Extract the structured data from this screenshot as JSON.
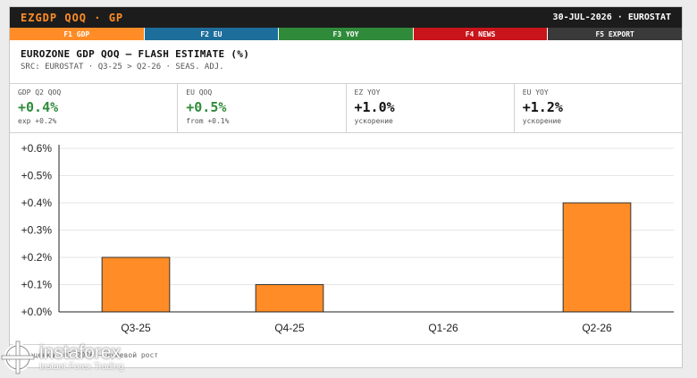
{
  "app": {
    "title": "EZGDP QOQ · GP",
    "date_source": "30-JUL-2026 · EUROSTAT"
  },
  "fkeys": [
    {
      "label": "F1 GDP",
      "color": "#ff8c26"
    },
    {
      "label": "F2 EU",
      "color": "#1e6e9c"
    },
    {
      "label": "F3 YOY",
      "color": "#2f8b3a"
    },
    {
      "label": "F4 NEWS",
      "color": "#c8141a"
    },
    {
      "label": "F5 EXPORT",
      "color": "#3a3a3a"
    }
  ],
  "header": {
    "title": "EUROZONE GDP QOQ — FLASH ESTIMATE (%)",
    "subtitle": "SRC: EUROSTAT · Q3-25 > Q2-26 · SEAS. ADJ."
  },
  "stats": [
    {
      "label": "GDP Q2 QOQ",
      "value": "+0.4%",
      "note": "exp +0.2%",
      "color": "#2f8b3a"
    },
    {
      "label": "EU QOQ",
      "value": "+0.5%",
      "note": "from +0.1%",
      "color": "#2f8b3a"
    },
    {
      "label": "EZ YOY",
      "value": "+1.0%",
      "note": "ускорение",
      "color": "#111111"
    },
    {
      "label": "EU YOY",
      "value": "+1.2%",
      "note": "ускорение",
      "color": "#111111"
    }
  ],
  "chart_data": {
    "type": "bar",
    "categories": [
      "Q3-25",
      "Q4-25",
      "Q1-26",
      "Q2-26"
    ],
    "values": [
      0.2,
      0.1,
      0.0,
      0.4
    ],
    "y_ticks": [
      "+0.0%",
      "+0.1%",
      "+0.2%",
      "+0.3%",
      "+0.4%",
      "+0.5%",
      "+0.6%"
    ],
    "ylim": [
      0,
      0.6
    ],
    "bar_color": "#ff8c26",
    "grid": true
  },
  "footnote": "…-оценка, Q1 2026 — нулевой рост",
  "watermark": {
    "name": "instaforex",
    "tagline": "Instant Forex Trading"
  }
}
